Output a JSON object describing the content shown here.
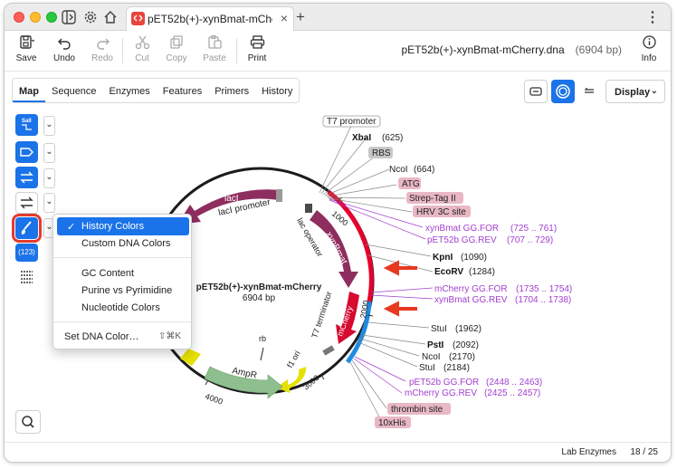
{
  "tab": {
    "title": "pET52b(+)-xynBmat-mCherry"
  },
  "toolbar": {
    "save": "Save",
    "undo": "Undo",
    "redo": "Redo",
    "cut": "Cut",
    "copy": "Copy",
    "paste": "Paste",
    "print": "Print",
    "info": "Info",
    "doc_title": "pET52b(+)-xynBmat-mCherry.dna",
    "doc_length": "(6904 bp)"
  },
  "view_tabs": [
    "Map",
    "Sequence",
    "Enzymes",
    "Features",
    "Primers",
    "History"
  ],
  "display": {
    "label": "Display"
  },
  "left_tools": {
    "badge": "(123)"
  },
  "menu": {
    "items": [
      "History Colors",
      "Custom DNA Colors",
      "GC Content",
      "Purine vs Pyrimidine",
      "Nucleotide Colors",
      "Set DNA Color…"
    ],
    "shortcut": "⇧⌘K",
    "checked": "History Colors"
  },
  "map": {
    "name": "pET52b(+)-xynBmat-mCherry",
    "length": "6904 bp",
    "ticks": [
      "1000",
      "2000",
      "3000",
      "4000"
    ],
    "features": {
      "lacI": "lacI",
      "lacI_promoter": "lacI promoter",
      "lac_operator": "lac operator",
      "xynBmat": "xynBmat",
      "mCherry": "mCherry",
      "t7_terminator": "T7 terminator",
      "f1_ori": "f1 ori",
      "ampr": "AmpR",
      "rb": "rb"
    },
    "labels": {
      "t7_promoter": "T7 promoter",
      "xbai": "XbaI",
      "xbai_pos": "(625)",
      "rbs": "RBS",
      "ncoi": "NcoI",
      "ncoi_pos": "(664)",
      "atg": "ATG",
      "strep": "Strep-Tag II",
      "hrv": "HRV 3C site",
      "xyn_for": "xynBmat GG.FOR",
      "xyn_for_pos": "(725 .. 761)",
      "pet_rev": "pET52b GG.REV",
      "pet_rev_pos": "(707 .. 729)",
      "kpni": "KpnI",
      "kpni_pos": "(1090)",
      "ecorv": "EcoRV",
      "ecorv_pos": "(1284)",
      "mch_for": "mCherry GG.FOR",
      "mch_for_pos": "(1735 .. 1754)",
      "xyn_rev": "xynBmat GG.REV",
      "xyn_rev_pos": "(1704 .. 1738)",
      "stui1": "StuI",
      "stui1_pos": "(1962)",
      "psti": "PstI",
      "psti_pos": "(2092)",
      "ncoi2": "NcoI",
      "ncoi2_pos": "(2170)",
      "stui2": "StuI",
      "stui2_pos": "(2184)",
      "pet_for": "pET52b GG.FOR",
      "pet_for_pos": "(2448 .. 2463)",
      "mch_rev": "mCherry GG.REV",
      "mch_rev_pos": "(2425 .. 2457)",
      "thrombin": "thrombin site",
      "his": "10xHis"
    }
  },
  "status": {
    "enzymes": "Lab Enzymes",
    "count": "18 / 25"
  },
  "colors": {
    "accent": "#1a73e8",
    "history_red": "#e8002d",
    "history_blue": "#1f8be0",
    "lacI": "#8e2e5f",
    "xynBmat": "#8e2e5f",
    "mCherry": "#d70a2f",
    "ampr": "#8fbf8f",
    "primer": "#a23fd0",
    "arrow": "#e8391f"
  }
}
